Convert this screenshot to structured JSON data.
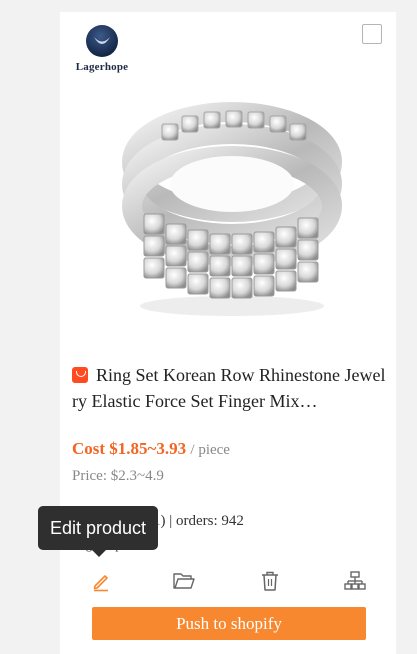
{
  "brand": {
    "logo_text": "Lagerhope"
  },
  "product": {
    "title": "Ring Set Korean Row Rhinestone Jewelry Elastic Force Set Finger Mix…",
    "cost_label": "Cost $1.85~3.93",
    "cost_unit": "/ piece",
    "price": "Price: $2.3~4.9",
    "rating_count": "(21)",
    "separator": "|",
    "orders": "orders: 942",
    "stars_glyph": "★★★★★",
    "obscured_text": "Lagerhop"
  },
  "actions": {
    "edit_icon": "pencil-icon",
    "folder_icon": "folder-open-icon",
    "delete_icon": "trash-icon",
    "sitemap_icon": "sitemap-icon",
    "push_label": "Push to shopify"
  },
  "tooltip": {
    "text": "Edit product"
  },
  "colors": {
    "accent_orange": "#f7882f",
    "cost_orange": "#f26522",
    "tooltip_bg": "#2f2f2f"
  }
}
